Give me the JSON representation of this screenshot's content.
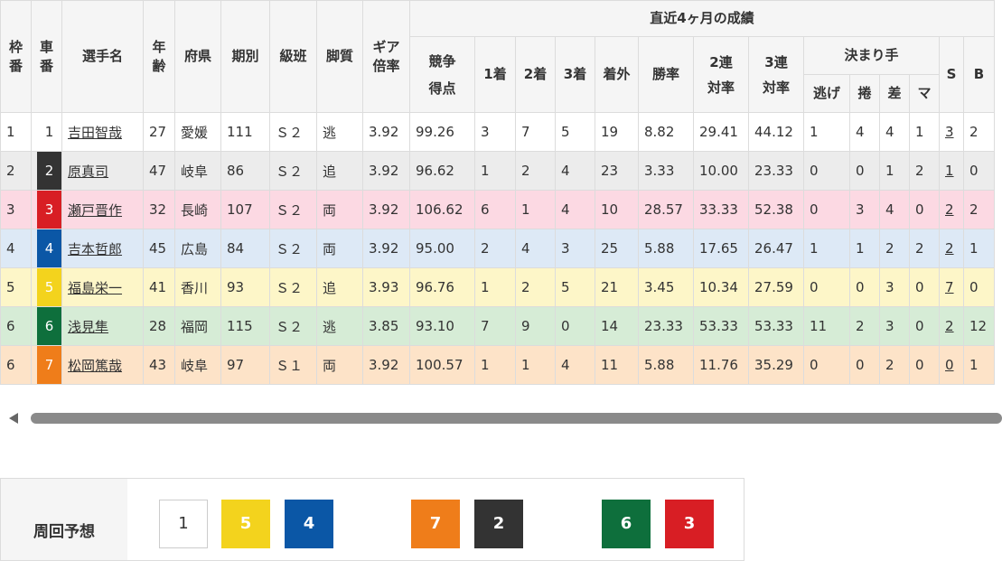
{
  "header": {
    "waku": "枠番",
    "shaban": "車番",
    "name": "選手名",
    "age": "年齢",
    "pref": "府県",
    "term": "期別",
    "class": "級班",
    "style": "脚質",
    "gear": "ギア倍率",
    "score": "競争得点",
    "recent": "直近4ヶ月の成績",
    "first": "1着",
    "second": "2着",
    "third": "3着",
    "out": "着外",
    "win_rate": "勝率",
    "rate2": "2連対率",
    "rate3": "3連対率",
    "kimarite": "決まり手",
    "nige": "逃げ",
    "makuri": "捲",
    "sashi": "差",
    "ma": "マ",
    "s": "S",
    "b": "B"
  },
  "rows": [
    {
      "waku": "1",
      "car": "1",
      "name": "吉田智哉",
      "age": "27",
      "pref": "愛媛",
      "term": "111",
      "class": "Ｓ２",
      "style": "逃",
      "gear": "3.92",
      "score": "99.26",
      "f1": "3",
      "f2": "7",
      "f3": "5",
      "out": "19",
      "win": "8.82",
      "r2": "29.41",
      "r3": "44.12",
      "nige": "1",
      "makuri": "4",
      "sashi": "4",
      "ma": "1",
      "s": "3",
      "b": "2",
      "bg": "#ffffff",
      "car_bg": "#ffffff",
      "car_color": "#333333"
    },
    {
      "waku": "2",
      "car": "2",
      "name": "原真司",
      "age": "47",
      "pref": "岐阜",
      "term": "86",
      "class": "Ｓ２",
      "style": "追",
      "gear": "3.92",
      "score": "96.62",
      "f1": "1",
      "f2": "2",
      "f3": "4",
      "out": "23",
      "win": "3.33",
      "r2": "10.00",
      "r3": "23.33",
      "nige": "0",
      "makuri": "0",
      "sashi": "1",
      "ma": "2",
      "s": "1",
      "b": "0",
      "bg": "#ececec",
      "car_bg": "#333333",
      "car_color": "#ffffff"
    },
    {
      "waku": "3",
      "car": "3",
      "name": "瀬戸晋作",
      "age": "32",
      "pref": "長崎",
      "term": "107",
      "class": "Ｓ２",
      "style": "両",
      "gear": "3.92",
      "score": "106.62",
      "f1": "6",
      "f2": "1",
      "f3": "4",
      "out": "10",
      "win": "28.57",
      "r2": "33.33",
      "r3": "52.38",
      "nige": "0",
      "makuri": "3",
      "sashi": "4",
      "ma": "0",
      "s": "2",
      "b": "2",
      "bg": "#fcd9e3",
      "car_bg": "#d81e24",
      "car_color": "#ffffff"
    },
    {
      "waku": "4",
      "car": "4",
      "name": "吉本哲郎",
      "age": "45",
      "pref": "広島",
      "term": "84",
      "class": "Ｓ２",
      "style": "両",
      "gear": "3.92",
      "score": "95.00",
      "f1": "2",
      "f2": "4",
      "f3": "3",
      "out": "25",
      "win": "5.88",
      "r2": "17.65",
      "r3": "26.47",
      "nige": "1",
      "makuri": "1",
      "sashi": "2",
      "ma": "2",
      "s": "2",
      "b": "1",
      "bg": "#dde9f6",
      "car_bg": "#0b57a6",
      "car_color": "#ffffff"
    },
    {
      "waku": "5",
      "car": "5",
      "name": "福島栄一",
      "age": "41",
      "pref": "香川",
      "term": "93",
      "class": "Ｓ２",
      "style": "追",
      "gear": "3.93",
      "score": "96.76",
      "f1": "1",
      "f2": "2",
      "f3": "5",
      "out": "21",
      "win": "3.45",
      "r2": "10.34",
      "r3": "27.59",
      "nige": "0",
      "makuri": "0",
      "sashi": "3",
      "ma": "0",
      "s": "7",
      "b": "0",
      "bg": "#fdf6c8",
      "car_bg": "#f3d31d",
      "car_color": "#ffffff"
    },
    {
      "waku": "6",
      "car": "6",
      "name": "浅見隼",
      "age": "28",
      "pref": "福岡",
      "term": "115",
      "class": "Ｓ２",
      "style": "逃",
      "gear": "3.85",
      "score": "93.10",
      "f1": "7",
      "f2": "9",
      "f3": "0",
      "out": "14",
      "win": "23.33",
      "r2": "53.33",
      "r3": "53.33",
      "nige": "11",
      "makuri": "2",
      "sashi": "3",
      "ma": "0",
      "s": "2",
      "b": "12",
      "bg": "#d6ecd6",
      "car_bg": "#0e6f3c",
      "car_color": "#ffffff"
    },
    {
      "waku": "6",
      "car": "7",
      "name": "松岡篤哉",
      "age": "43",
      "pref": "岐阜",
      "term": "97",
      "class": "Ｓ１",
      "style": "両",
      "gear": "3.92",
      "score": "100.57",
      "f1": "1",
      "f2": "1",
      "f3": "4",
      "out": "11",
      "win": "5.88",
      "r2": "11.76",
      "r3": "35.29",
      "nige": "0",
      "makuri": "0",
      "sashi": "2",
      "ma": "0",
      "s": "0",
      "b": "1",
      "bg": "#fde3c8",
      "car_bg": "#ef7d1a",
      "car_color": "#ffffff"
    }
  ],
  "rounds": {
    "label": "周回予想",
    "chips": [
      {
        "value": "1",
        "bg": "#ffffff",
        "color": "#333333"
      },
      {
        "value": "5",
        "bg": "#f3d31d",
        "color": "#ffffff"
      },
      {
        "value": "4",
        "bg": "#0b57a6",
        "color": "#ffffff"
      },
      {
        "value": "7",
        "bg": "#ef7d1a",
        "color": "#ffffff"
      },
      {
        "value": "2",
        "bg": "#333333",
        "color": "#ffffff"
      },
      {
        "value": "6",
        "bg": "#0e6f3c",
        "color": "#ffffff"
      },
      {
        "value": "3",
        "bg": "#d81e24",
        "color": "#ffffff"
      }
    ]
  }
}
